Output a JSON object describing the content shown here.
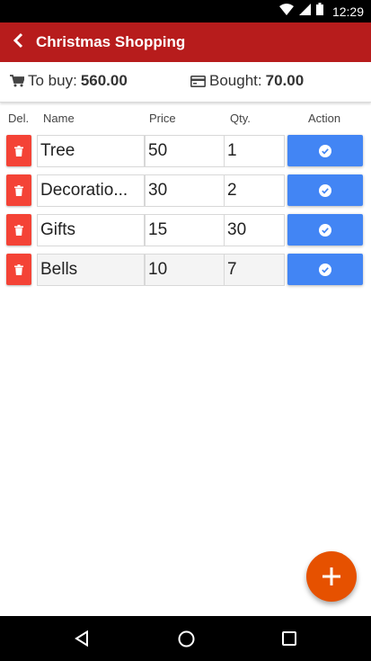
{
  "status_bar": {
    "time": "12:29"
  },
  "app_bar": {
    "title": "Christmas Shopping",
    "back_icon": "chevron-left-icon"
  },
  "summary": {
    "to_buy_label": "To buy:",
    "to_buy_value": "560.00",
    "bought_label": "Bought:",
    "bought_value": "70.00"
  },
  "columns": {
    "del": "Del.",
    "name": "Name",
    "price": "Price",
    "qty": "Qty.",
    "action": "Action"
  },
  "items": [
    {
      "name": "Tree",
      "price": "50",
      "qty": "1"
    },
    {
      "name": "Decoratio...",
      "price": "30",
      "qty": "2"
    },
    {
      "name": "Gifts",
      "price": "15",
      "qty": "30"
    },
    {
      "name": "Bells",
      "price": "10",
      "qty": "7"
    }
  ],
  "colors": {
    "app_bar": "#b71c1c",
    "delete_button": "#f44336",
    "action_button": "#4285f4",
    "fab": "#e65100"
  },
  "icons": {
    "delete": "trash-icon",
    "action": "check-circle-icon",
    "fab": "plus-icon",
    "cart": "cart-icon",
    "card": "credit-card-icon"
  }
}
